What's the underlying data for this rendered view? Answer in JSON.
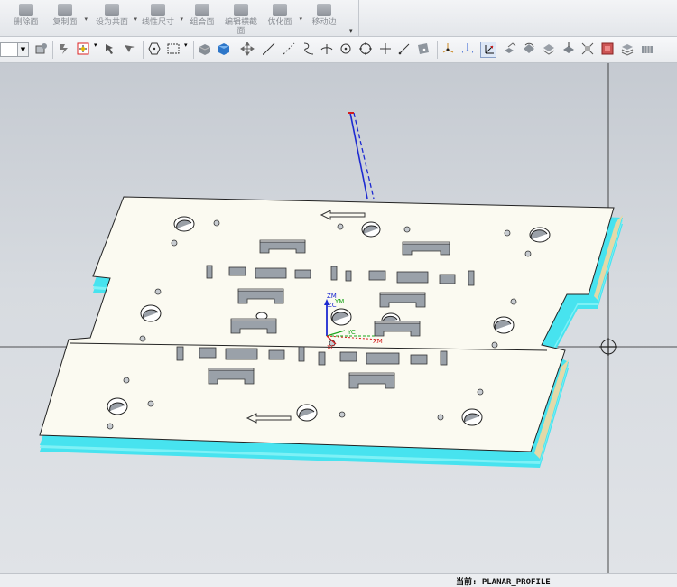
{
  "ribbon": {
    "buttons": [
      {
        "label": "删除面"
      },
      {
        "label": "复制面"
      },
      {
        "label": "设为共面"
      },
      {
        "label": "线性尺寸"
      },
      {
        "label": "组合面"
      },
      {
        "label": "编辑横截面"
      },
      {
        "label": "优化面"
      },
      {
        "label": "移动边"
      }
    ]
  },
  "viewport": {
    "wcs_labels": {
      "zm": "ZM",
      "zc": "ZC",
      "ym": "YM",
      "yc": "YC",
      "xc": "XC",
      "xm": "XM"
    }
  },
  "status": {
    "text": "当前: PLANAR_PROFILE"
  },
  "colors": {
    "plate_top": "#fbfaf1",
    "plate_edge": "#47e3ef",
    "wcs_z": "#1d2ad1",
    "wcs_y": "#1ba51b",
    "wcs_x": "#d21c1c"
  }
}
